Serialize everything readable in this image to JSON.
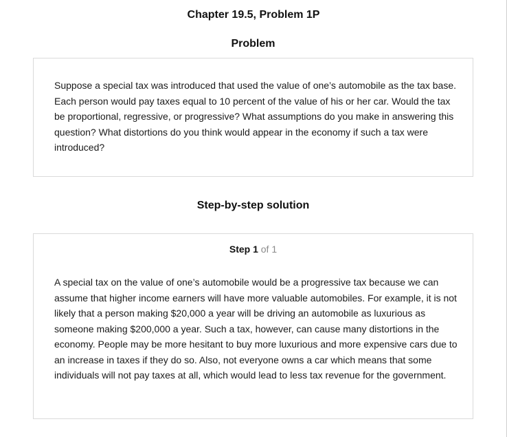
{
  "header": {
    "title": "Chapter 19.5, Problem 1P"
  },
  "problem": {
    "heading": "Problem",
    "text": "Suppose a special tax was introduced that used the value of one’s automobile as the tax base. Each person would pay taxes equal to 10 percent of the value of his or her car. Would the tax be proportional, regressive, or progressive? What assumptions do you make in answering this question? What distortions do you think would appear in the economy if such a tax were introduced?"
  },
  "solution": {
    "heading": "Step-by-step solution",
    "step": {
      "label": "Step 1",
      "of": "of 1",
      "text": "A special tax on the value of one’s automobile would be a progressive tax because we can assume that higher income earners will have more valuable automobiles. For example, it is not likely that a person making $20,000 a year will be driving an automobile as luxurious as someone making $200,000 a year. Such a tax, however, can cause many distortions in the economy. People may be more hesitant to buy more luxurious and more expensive cars due to an increase in taxes if they do so. Also, not everyone owns a car which means that some individuals will not pay taxes at all, which would lead to less tax revenue for the government."
    }
  }
}
